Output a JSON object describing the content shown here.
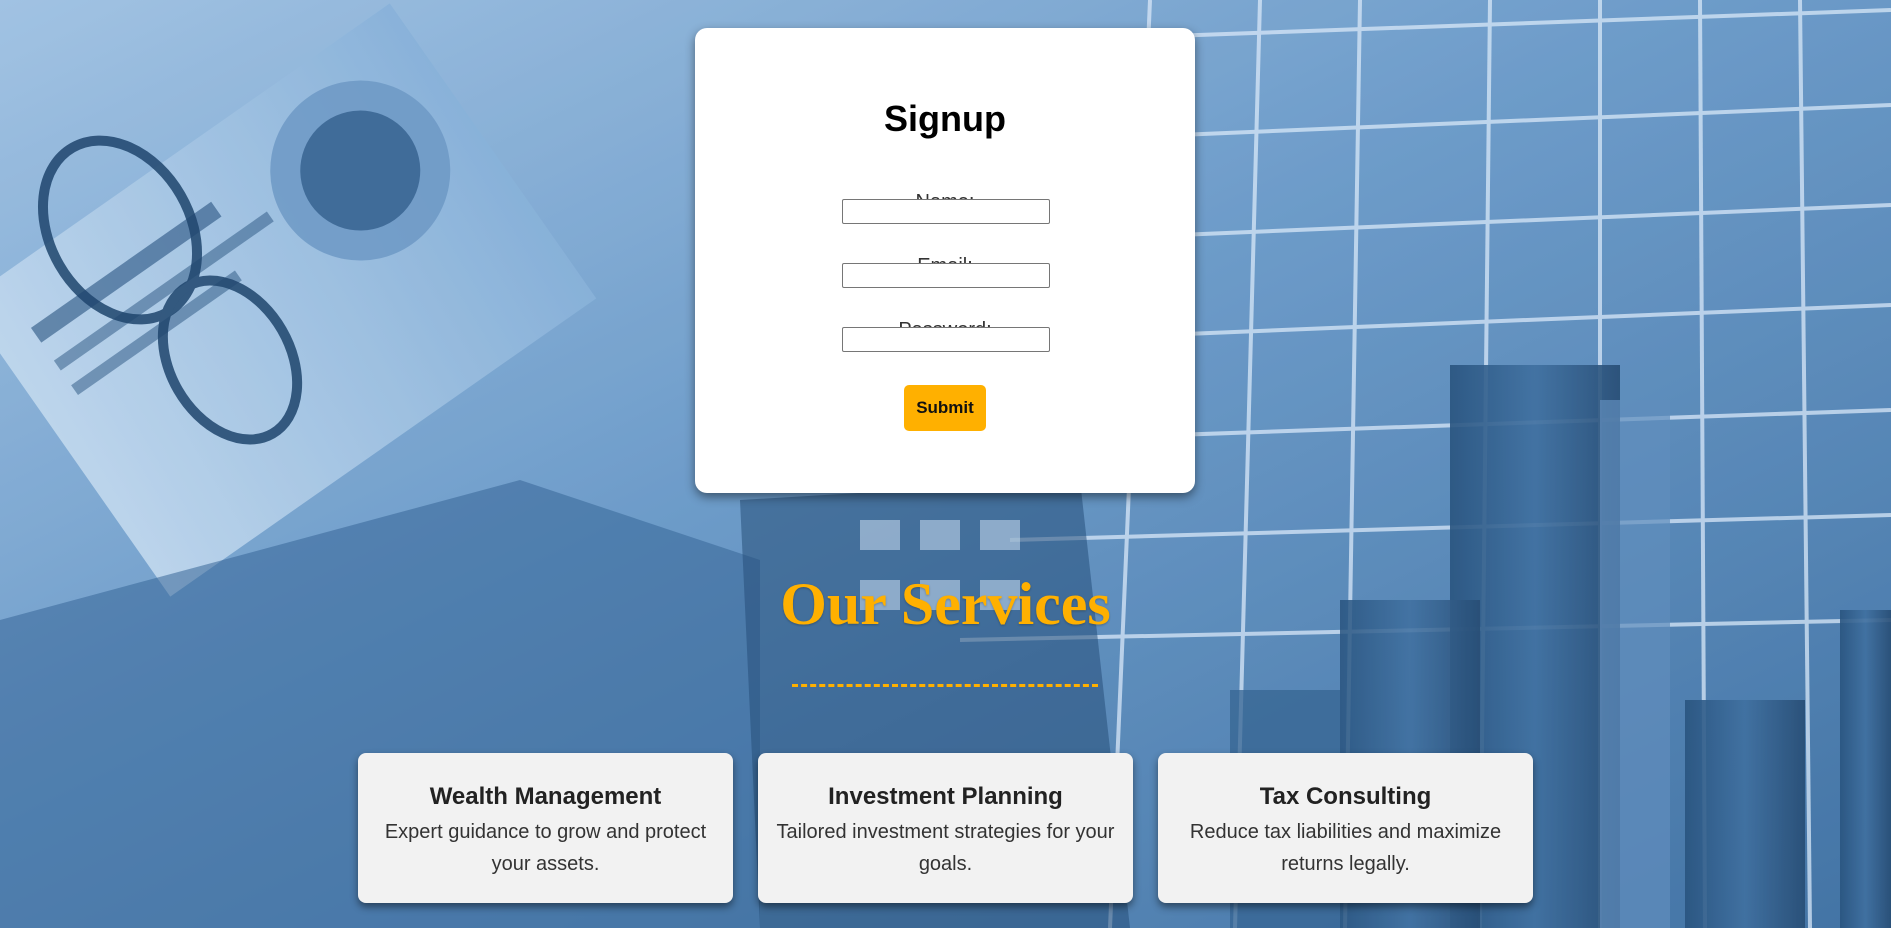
{
  "signup": {
    "title": "Signup",
    "name_label": "Name:",
    "name_value": "",
    "email_label": "Email:",
    "email_value": "",
    "password_label": "Password:",
    "password_value": "",
    "submit_label": "Submit"
  },
  "services": {
    "title": "Our Services",
    "divider": "------------------------",
    "items": [
      {
        "name": "Wealth Management",
        "description": "Expert guidance to grow and protect your assets."
      },
      {
        "name": "Investment Planning",
        "description": "Tailored investment strategies for your goals."
      },
      {
        "name": "Tax Consulting",
        "description": "Reduce tax liabilities and maximize returns legally."
      }
    ]
  },
  "colors": {
    "accent": "#ffb000",
    "card_bg": "#ffffff",
    "service_card_bg": "#f2f2f2",
    "background_tint": "#5f8fbd"
  }
}
